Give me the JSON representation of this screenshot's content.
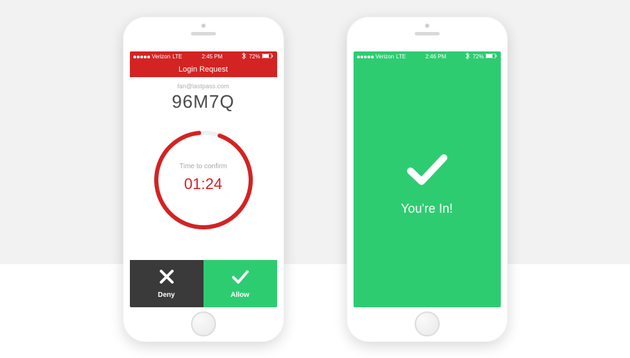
{
  "statusbar": {
    "carrier": "Verizon",
    "network": "LTE",
    "time_left": "2:45 PM",
    "time_right": "2:46 PM",
    "battery": "72%"
  },
  "left": {
    "title": "Login Request",
    "email": "fan@lastpass.com",
    "code": "96M7Q",
    "timer_label": "Time to confirm",
    "timer_value": "01:24",
    "deny_label": "Deny",
    "allow_label": "Allow"
  },
  "right": {
    "success": "You're In!"
  },
  "colors": {
    "red": "#d32323",
    "green": "#2ecc71",
    "dark": "#3a3a3a"
  }
}
